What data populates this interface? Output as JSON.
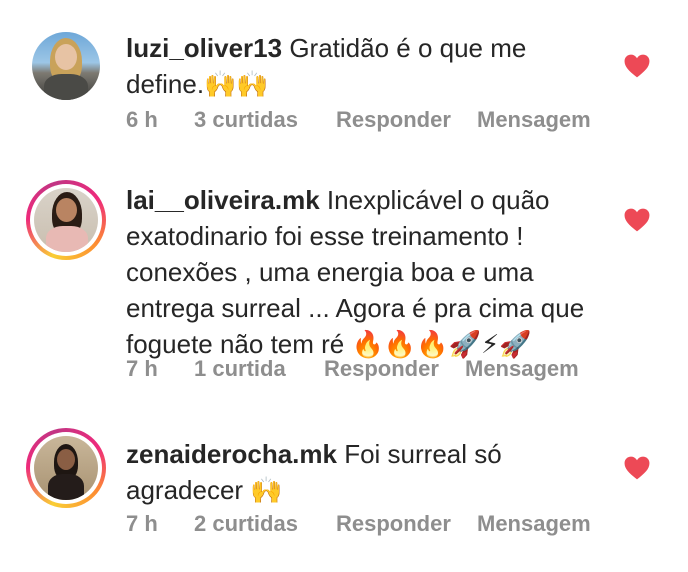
{
  "comments": [
    {
      "username": "luzi_oliver13",
      "text": "Gratidão é o que me define.🙌🙌",
      "time": "6 h",
      "likes": "3 curtidas",
      "reply_label": "Responder",
      "message_label": "Mensagem",
      "liked": true
    },
    {
      "username": "lai__oliveira.mk",
      "text": "Inexplicável o quão exatodinario foi esse treinamento ! conexões , uma energia boa e uma entrega surreal ... Agora é pra cima que foguete não tem ré 🔥🔥🔥🚀⚡🚀",
      "time": "7 h",
      "likes": "1 curtida",
      "reply_label": "Responder",
      "message_label": "Mensagem",
      "liked": true
    },
    {
      "username": "zenaiderocha.mk",
      "text": "Foi surreal só agradecer 🙌",
      "time": "7 h",
      "likes": "2 curtidas",
      "reply_label": "Responder",
      "message_label": "Mensagem",
      "liked": true
    }
  ],
  "colors": {
    "heart": "#ed4956",
    "meta_text": "#8e8e8e",
    "primary_text": "#262626"
  }
}
